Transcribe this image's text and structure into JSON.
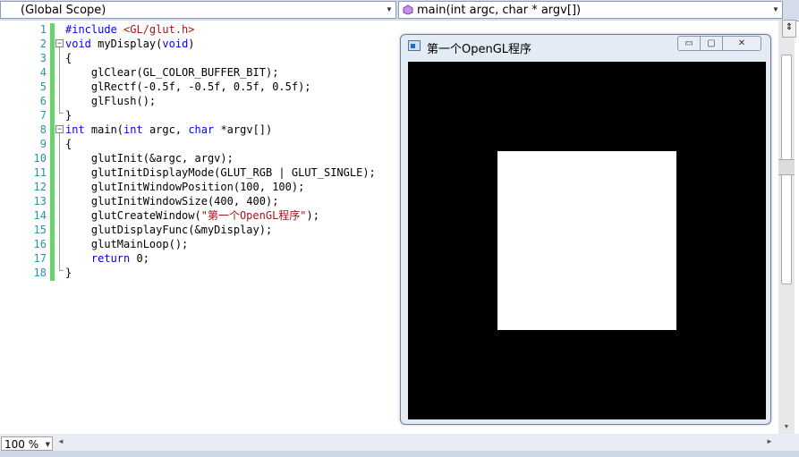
{
  "toolbar": {
    "scope_dropdown": "(Global Scope)",
    "function_dropdown": "main(int argc, char * argv[])"
  },
  "editor": {
    "line_numbers": [
      "1",
      "2",
      "3",
      "4",
      "5",
      "6",
      "7",
      "8",
      "9",
      "10",
      "11",
      "12",
      "13",
      "14",
      "15",
      "16",
      "17",
      "18"
    ],
    "lines": {
      "l1_pp": "#include",
      "l1_str": "<GL/glut.h>",
      "l2_kw": "void",
      "l2_a": " myDisplay(",
      "l2_kw2": "void",
      "l2_b": ")",
      "l3": "{",
      "l4": "    glClear(GL_COLOR_BUFFER_BIT);",
      "l5": "    glRectf(-0.5f, -0.5f, 0.5f, 0.5f);",
      "l6": "    glFlush();",
      "l7": "}",
      "l8_kw": "int",
      "l8_a": " main(",
      "l8_kw2": "int",
      "l8_b": " argc, ",
      "l8_kw3": "char",
      "l8_c": " *argv[])",
      "l9": "{",
      "l10": "    glutInit(&argc, argv);",
      "l11": "    glutInitDisplayMode(GLUT_RGB | GLUT_SINGLE);",
      "l12": "    glutInitWindowPosition(100, 100);",
      "l13": "    glutInitWindowSize(400, 400);",
      "l14_a": "    glutCreateWindow(",
      "l14_str": "\"第一个OpenGL程序\"",
      "l14_b": ");",
      "l15": "    glutDisplayFunc(&myDisplay);",
      "l16": "    glutMainLoop();",
      "l17_kw": "return",
      "l17_b": " 0;",
      "l18": "}"
    }
  },
  "statusbar": {
    "zoom": "100 %"
  },
  "gl_window": {
    "title": "第一个OpenGL程序",
    "minimize": "▭",
    "maximize": "▢",
    "close": "✕"
  },
  "colors": {
    "keyword": "#0000ff",
    "string": "#a31515",
    "line_number": "#2b91af",
    "change_bar": "#6ad46a"
  }
}
